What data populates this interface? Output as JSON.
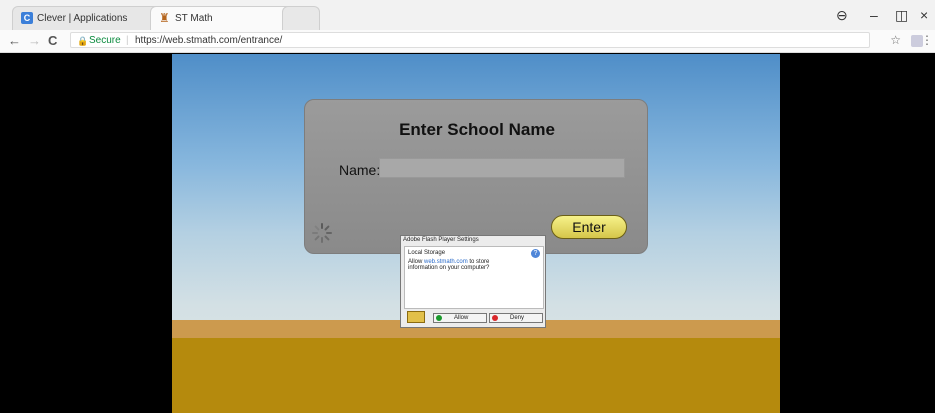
{
  "browser": {
    "tabs": [
      {
        "title": "Clever | Applications",
        "close": "×"
      },
      {
        "title": "ST Math",
        "close": "×"
      }
    ],
    "secure_label": "Secure",
    "url": "https://web.stmath.com/entrance/",
    "nav": {
      "back": "←",
      "forward": "→",
      "reload": "C"
    },
    "window_controls": {
      "profile": "⊖",
      "minimize": "–",
      "restore": "◫",
      "close": "×"
    },
    "star": "☆",
    "menu": "⋮"
  },
  "app": {
    "title": "Enter School Name",
    "name_label": "Name:",
    "name_value": "",
    "enter_button": "Enter"
  },
  "flash_dialog": {
    "title": "Adobe Flash Player Settings",
    "section": "Local Storage",
    "message_prefix": "Allow ",
    "message_link": "web.stmath.com",
    "message_suffix": " to store information on your computer?",
    "help": "?",
    "allow": "Allow",
    "deny": "Deny"
  },
  "colors": {
    "secure_green": "#0a8a3d",
    "enter_yellow": "#f7f28a",
    "allow_green": "#1a9a2c",
    "deny_red": "#d9262a"
  }
}
